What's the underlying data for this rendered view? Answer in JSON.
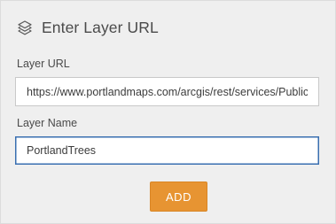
{
  "header": {
    "icon": "layers-icon",
    "title": "Enter Layer URL"
  },
  "form": {
    "url_label": "Layer URL",
    "url_value": "https://www.portlandmaps.com/arcgis/rest/services/Public",
    "name_label": "Layer Name",
    "name_value": "PortlandTrees"
  },
  "actions": {
    "add_label": "ADD"
  },
  "colors": {
    "panel_background": "#efefef",
    "accent_button": "#e79432",
    "focused_border": "#3a6fb0"
  }
}
